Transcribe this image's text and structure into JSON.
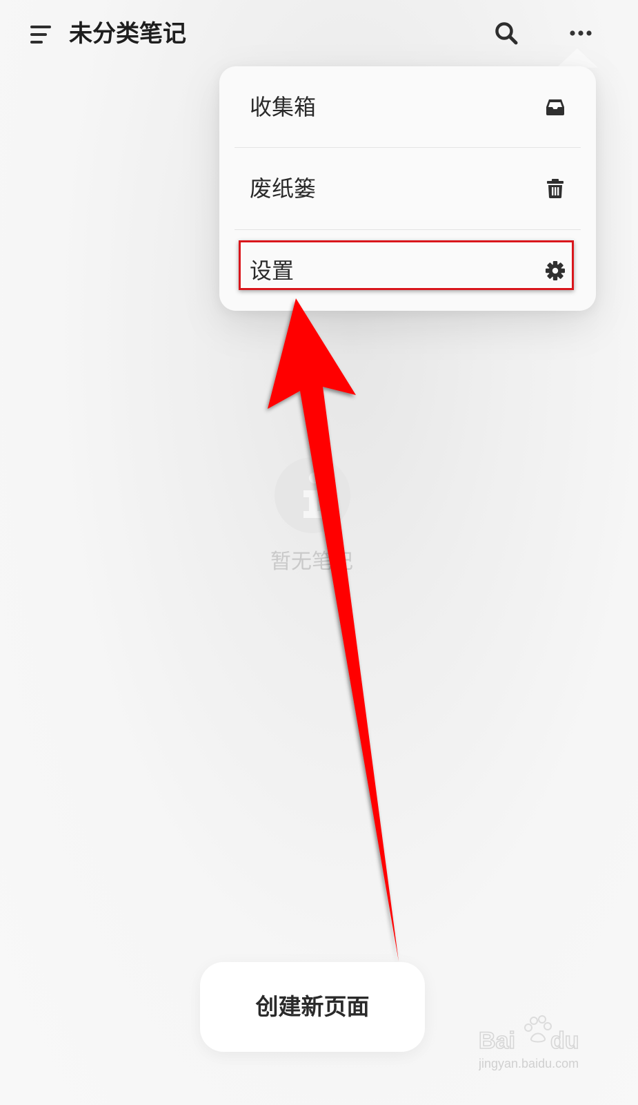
{
  "header": {
    "title": "未分类笔记",
    "menu_icon": "menu-icon",
    "search_icon": "search-icon",
    "more_icon": "more-icon"
  },
  "dropdown": {
    "items": [
      {
        "label": "收集箱",
        "icon": "inbox-icon"
      },
      {
        "label": "废纸篓",
        "icon": "trash-icon"
      },
      {
        "label": "设置",
        "icon": "gear-icon",
        "highlighted": true
      }
    ]
  },
  "empty_state": {
    "icon": "info-icon",
    "text": "暂无笔记"
  },
  "create_button": {
    "label": "创建新页面"
  },
  "annotation": {
    "arrow_color": "#ff0000",
    "highlight_color": "#d9161c"
  },
  "watermark": {
    "brand": "Baidu经验",
    "url": "jingyan.baidu.com"
  }
}
